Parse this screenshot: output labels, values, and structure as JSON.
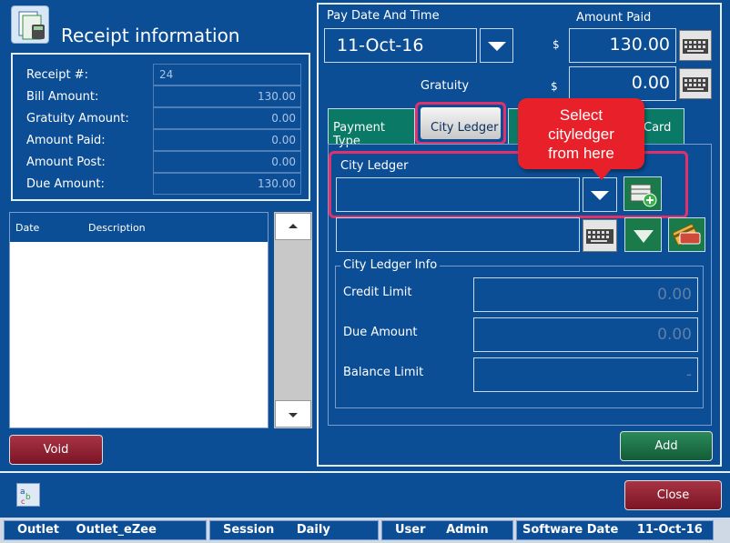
{
  "header": {
    "title": "Receipt information"
  },
  "receipt": {
    "rows": [
      {
        "label": "Receipt #:",
        "value": "24"
      },
      {
        "label": "Bill Amount:",
        "value": "130.00"
      },
      {
        "label": "Gratuity Amount:",
        "value": "0.00"
      },
      {
        "label": "Amount Paid:",
        "value": "0.00"
      },
      {
        "label": "Amount Post:",
        "value": "0.00"
      },
      {
        "label": "Due Amount:",
        "value": "130.00"
      }
    ]
  },
  "table": {
    "col_date": "Date",
    "col_desc": "Description"
  },
  "buttons": {
    "void": "Void",
    "add": "Add",
    "close": "Close"
  },
  "payment": {
    "pay_date_label": "Pay Date And Time",
    "pay_date_value": "11-Oct-16",
    "amount_paid_label": "Amount Paid",
    "currency": "$",
    "amount_paid_value": "130.00",
    "gratuity_label": "Gratuity",
    "gratuity_value": "0.00"
  },
  "tabs": {
    "payment_type": "Payment Type",
    "city_ledger": "City Ledger",
    "card": "Card"
  },
  "callout": {
    "text": "Select cityledger from here"
  },
  "city_ledger": {
    "label": "City Ledger",
    "info_title": "City Ledger Info",
    "credit_limit_label": "Credit Limit",
    "credit_limit_value": "0.00",
    "due_amount_label": "Due Amount",
    "due_amount_value": "0.00",
    "balance_limit_label": "Balance Limit",
    "balance_limit_value": "-"
  },
  "status": {
    "outlet_label": "Outlet",
    "outlet_value": "Outlet_eZee",
    "session_label": "Session",
    "session_value": "Daily",
    "user_label": "User",
    "user_value": "Admin",
    "software_date_label": "Software Date",
    "software_date_value": "11-Oct-16"
  },
  "colors": {
    "background": "#0c4e96",
    "callout": "#e8202a",
    "accent_green": "#1a7a4a",
    "accent_red": "#8b1a2a"
  }
}
